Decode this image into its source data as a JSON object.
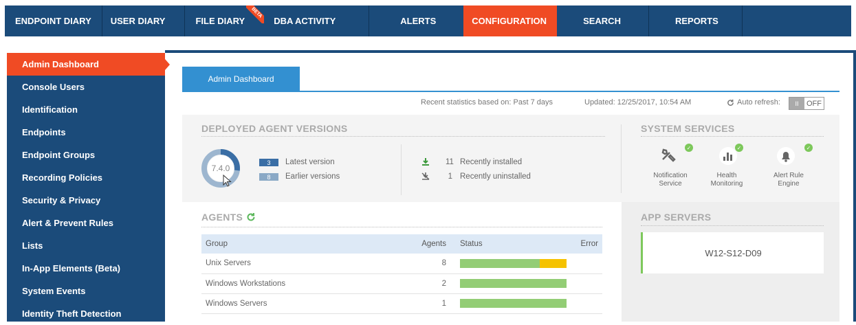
{
  "nav": {
    "items": [
      {
        "label": "ENDPOINT DIARY"
      },
      {
        "label": "USER DIARY"
      },
      {
        "label": "FILE DIARY",
        "badge": "BETA"
      },
      {
        "label": "DBA ACTIVITY"
      },
      {
        "label": "ALERTS"
      },
      {
        "label": "CONFIGURATION"
      },
      {
        "label": "SEARCH"
      },
      {
        "label": "REPORTS"
      }
    ]
  },
  "sidebar": {
    "items": [
      {
        "label": "Admin Dashboard"
      },
      {
        "label": "Console Users"
      },
      {
        "label": "Identification"
      },
      {
        "label": "Endpoints"
      },
      {
        "label": "Endpoint Groups"
      },
      {
        "label": "Recording Policies"
      },
      {
        "label": "Security & Privacy"
      },
      {
        "label": "Alert & Prevent Rules"
      },
      {
        "label": "Lists"
      },
      {
        "label": "In-App Elements (Beta)"
      },
      {
        "label": "System Events"
      },
      {
        "label": "Identity Theft Detection"
      }
    ]
  },
  "tab": {
    "label": "Admin Dashboard"
  },
  "stats": {
    "recent": "Recent statistics based on: Past 7 days",
    "updated": "Updated: 12/25/2017, 10:54 AM",
    "auto_refresh": "Auto refresh:",
    "toggle_knob": "II",
    "toggle_state": "OFF"
  },
  "agent_versions": {
    "title": "DEPLOYED AGENT VERSIONS",
    "version": "7.4.0",
    "latest_count": "3",
    "latest_label": "Latest version",
    "earlier_count": "8",
    "earlier_label": "Earlier versions",
    "latest_fraction": 0.27,
    "installed_count": "11",
    "installed_label": "Recently installed",
    "uninstalled_count": "1",
    "uninstalled_label": "Recently uninstalled",
    "colors": {
      "latest": "#3a6ea5",
      "earlier": "#9db6cf"
    }
  },
  "system_services": {
    "title": "SYSTEM SERVICES",
    "items": [
      {
        "label": "Notification Service",
        "icon": "tools-icon",
        "status": "ok"
      },
      {
        "label": "Health Monitoring",
        "icon": "bar-chart-icon",
        "status": "ok"
      },
      {
        "label": "Alert Rule Engine",
        "icon": "bell-icon",
        "status": "ok"
      }
    ]
  },
  "agents": {
    "title": "AGENTS",
    "columns": [
      "Group",
      "Agents",
      "Status",
      "Error"
    ],
    "rows": [
      {
        "group": "Unix Servers",
        "agents": "8",
        "ok_fraction": 0.75,
        "warn_fraction": 0.25
      },
      {
        "group": "Windows Workstations",
        "agents": "2",
        "ok_fraction": 1.0,
        "warn_fraction": 0
      },
      {
        "group": "Windows Servers",
        "agents": "1",
        "ok_fraction": 1.0,
        "warn_fraction": 0
      }
    ],
    "colors": {
      "ok": "#93cd75",
      "warn": "#f5c200"
    }
  },
  "app_servers": {
    "title": "APP SERVERS",
    "items": [
      {
        "name": "W12-S12-D09"
      }
    ]
  }
}
